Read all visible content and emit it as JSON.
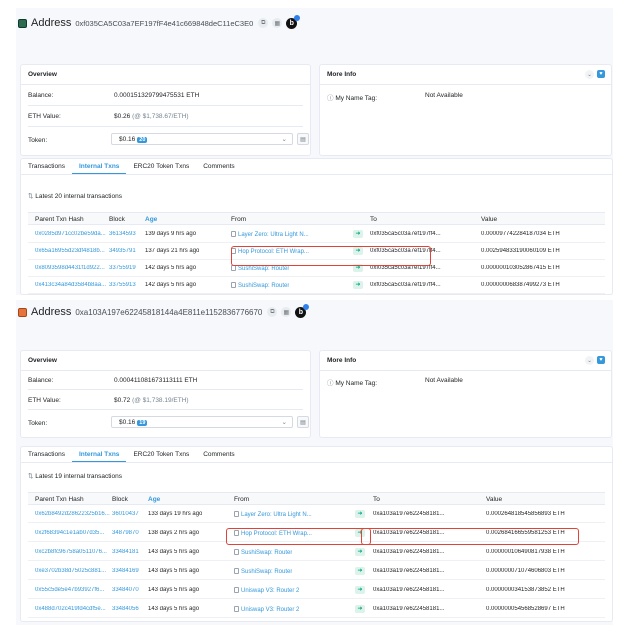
{
  "colors": {
    "accent": "#3498db",
    "highlight": "#de4437",
    "in_arrow_bg": "#dcf3e9",
    "in_arrow": "#00a186"
  },
  "top": {
    "header": {
      "label": "Address",
      "address": "0xf035CA5C03a7EF197fF4e41c669848deC11eC3E0",
      "logo_icon": "green-cube-icon"
    },
    "overview": {
      "title": "Overview",
      "balance_label": "Balance:",
      "balance_value": "0.000151329799475531 ETH",
      "eth_value_label": "ETH Value:",
      "eth_value": "$0.26",
      "eth_value_note": "(@ $1,738.67/ETH)",
      "token_label": "Token:",
      "token_value": "$0.16",
      "token_count": "20"
    },
    "more_info": {
      "title": "More Info",
      "name_tag_label": "My Name Tag:",
      "name_tag_value": "Not Available"
    },
    "tabs": [
      "Transactions",
      "Internal Txns",
      "ERC20 Token Txns",
      "Comments"
    ],
    "latest": "Latest 20 internal transactions",
    "columns": [
      "Parent Txn Hash",
      "Block",
      "Age",
      "From",
      "To",
      "Value"
    ],
    "rows": [
      {
        "hash": "0x0285d971cc02be59da...",
        "block": "36134593",
        "age": "139 days 9 hrs ago",
        "from": "Layer Zero: Ultra Light N...",
        "to": "0xf035ca5c03a7ef197ff4...",
        "value": "0.000097742284187034 ETH"
      },
      {
        "hash": "0x65a16955d23df4818b...",
        "block": "34935791",
        "age": "137 days 21 hrs ago",
        "from": "Hop Protocol: ETH Wrap...",
        "to": "0xf035ca5c03a7ef197ff4...",
        "value": "0.002594833190060109 ETH"
      },
      {
        "hash": "0x8093598d4431f1d922...",
        "block": "33755919",
        "age": "142 days 5 hrs ago",
        "from": "SushiSwap: Router",
        "to": "0xf035ca5c03a7ef197ff4...",
        "value": "0.000000103052867415 ETH"
      },
      {
        "hash": "0x413c34a84d3584b8aa...",
        "block": "33755913",
        "age": "142 days 5 hrs ago",
        "from": "SushiSwap: Router",
        "to": "0xf035ca5c03a7ef197ff4...",
        "value": "0.000000068387499273 ETH"
      }
    ]
  },
  "bottom": {
    "header": {
      "label": "Address",
      "address": "0xa103A197e62245818144a4E811e1152836776670",
      "logo_icon": "orange-square-icon"
    },
    "overview": {
      "title": "Overview",
      "balance_label": "Balance:",
      "balance_value": "0.000411081673113111 ETH",
      "eth_value_label": "ETH Value:",
      "eth_value": "$0.72",
      "eth_value_note": "(@ $1,738.19/ETH)",
      "token_label": "Token:",
      "token_value": "$0.16",
      "token_count": "19"
    },
    "more_info": {
      "title": "More Info",
      "name_tag_label": "My Name Tag:",
      "name_tag_value": "Not Available"
    },
    "tabs": [
      "Transactions",
      "Internal Txns",
      "ERC20 Token Txns",
      "Comments"
    ],
    "latest": "Latest 19 internal transactions",
    "columns": [
      "Parent Txn Hash",
      "Block",
      "Age",
      "From",
      "To",
      "Value"
    ],
    "rows": [
      {
        "hash": "0x62b8492d28622325b16...",
        "block": "36010437",
        "age": "133 days 19 hrs ago",
        "from": "Layer Zero: Ultra Light N...",
        "to": "0xa103a197e622458181...",
        "value": "0.000264818545856893 ETH"
      },
      {
        "hash": "0x2f68394c1e1ab07d35...",
        "block": "34879870",
        "age": "138 days 2 hrs ago",
        "from": "Hop Protocol: ETH Wrap...",
        "to": "0xa103a197e622458181...",
        "value": "0.002684166559581253 ETH"
      },
      {
        "hash": "0xc2b8fc96758a0511076...",
        "block": "33484181",
        "age": "143 days 5 hrs ago",
        "from": "SushiSwap: Router",
        "to": "0xa103a197e622458181...",
        "value": "0.000000106490817938 ETH"
      },
      {
        "hash": "0xe3702b38d75025c881...",
        "block": "33484169",
        "age": "143 days 5 hrs ago",
        "from": "SushiSwap: Router",
        "to": "0xa103a197e622458181...",
        "value": "0.000000071074606803 ETH"
      },
      {
        "hash": "0x55c5de5e47b93927f6...",
        "block": "33484070",
        "age": "143 days 5 hrs ago",
        "from": "Uniswap V3: Router 2",
        "to": "0xa103a197e622458181...",
        "value": "0.000000034153873852 ETH"
      },
      {
        "hash": "0x488d702c419fd4cdf5e...",
        "block": "33484056",
        "age": "143 days 5 hrs ago",
        "from": "Uniswap V3: Router 2",
        "to": "0xa103a197e622458181...",
        "value": "0.000000054568528697 ETH"
      }
    ]
  }
}
